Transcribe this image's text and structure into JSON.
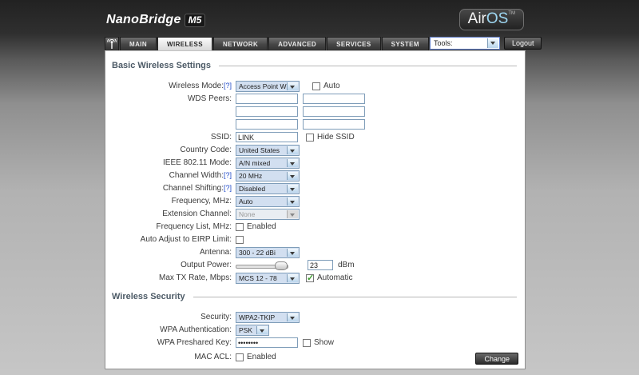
{
  "header": {
    "brand": "NanoBridge",
    "model": "M5",
    "logo": {
      "air": "Air",
      "os": "OS",
      "tm": "TM"
    }
  },
  "nav": {
    "tabs": [
      {
        "label": "MAIN"
      },
      {
        "label": "WIRELESS"
      },
      {
        "label": "NETWORK"
      },
      {
        "label": "ADVANCED"
      },
      {
        "label": "SERVICES"
      },
      {
        "label": "SYSTEM"
      }
    ],
    "tools": {
      "value": "Tools:"
    },
    "logout_label": "Logout"
  },
  "basic": {
    "title": "Basic Wireless Settings",
    "wireless_mode": {
      "label": "Wireless Mode:",
      "help": "[?]",
      "value": "Access Point WDS",
      "auto_label": "Auto"
    },
    "wds_peers": {
      "label": "WDS Peers:",
      "values": [
        "",
        "",
        "",
        "",
        "",
        ""
      ]
    },
    "ssid": {
      "label": "SSID:",
      "value": "LINK",
      "hide_label": "Hide SSID"
    },
    "country_code": {
      "label": "Country Code:",
      "value": "United States"
    },
    "ieee_mode": {
      "label": "IEEE 802.11 Mode:",
      "value": "A/N mixed"
    },
    "channel_width": {
      "label": "Channel Width:",
      "help": "[?]",
      "value": "20 MHz"
    },
    "channel_shifting": {
      "label": "Channel Shifting:",
      "help": "[?]",
      "value": "Disabled"
    },
    "frequency": {
      "label": "Frequency, MHz:",
      "value": "Auto"
    },
    "extension_channel": {
      "label": "Extension Channel:",
      "value": "None"
    },
    "frequency_list": {
      "label": "Frequency List, MHz:",
      "enabled_label": "Enabled"
    },
    "eirp_limit": {
      "label": "Auto Adjust to EIRP Limit:"
    },
    "antenna": {
      "label": "Antenna:",
      "value": "300 - 22 dBi"
    },
    "output_power": {
      "label": "Output Power:",
      "value": "23",
      "unit": "dBm"
    },
    "max_tx_rate": {
      "label": "Max TX Rate, Mbps:",
      "value": "MCS 12 - 78",
      "auto_label": "Automatic",
      "auto_checked": true
    }
  },
  "security": {
    "title": "Wireless Security",
    "security": {
      "label": "Security:",
      "value": "WPA2-TKIP"
    },
    "wpa_auth": {
      "label": "WPA Authentication:",
      "value": "PSK"
    },
    "wpa_key": {
      "label": "WPA Preshared Key:",
      "value": "••••••••",
      "show_label": "Show"
    },
    "mac_acl": {
      "label": "MAC ACL:",
      "enabled_label": "Enabled"
    }
  },
  "footer": {
    "change_label": "Change"
  }
}
